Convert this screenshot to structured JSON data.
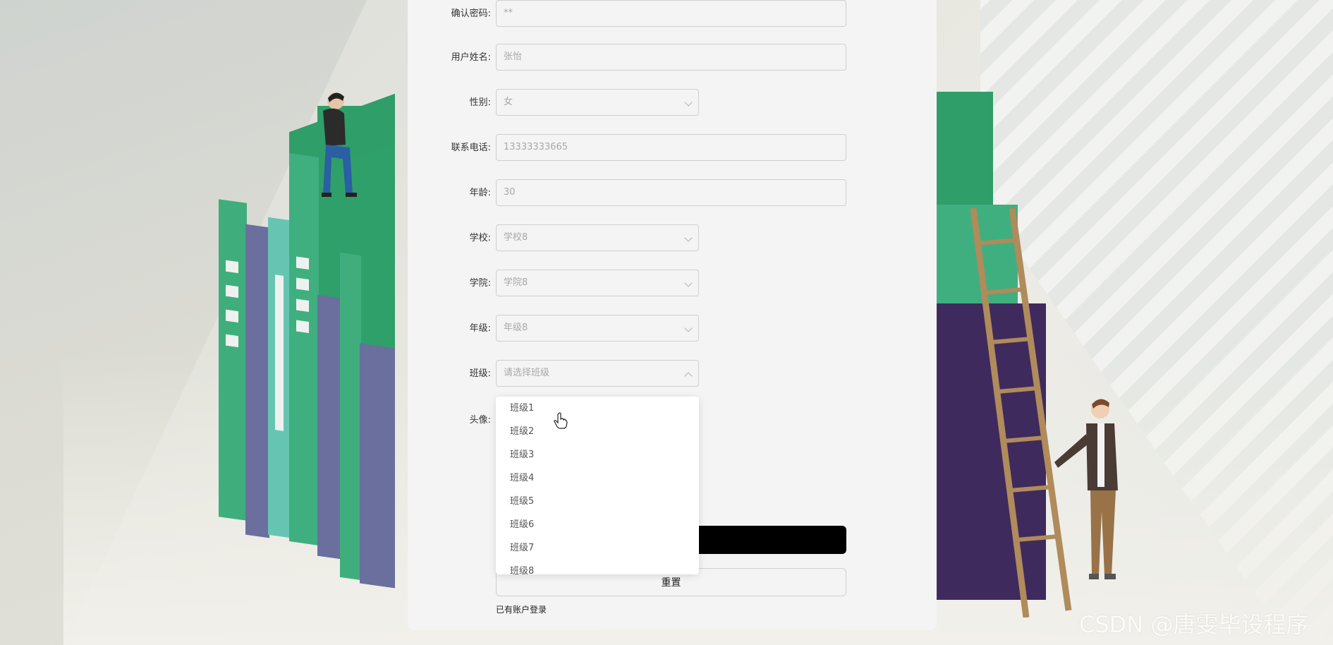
{
  "form": {
    "confirm_password": {
      "label": "确认密码:",
      "value": "**"
    },
    "user_name": {
      "label": "用户姓名:",
      "value": "张怡"
    },
    "gender": {
      "label": "性别:",
      "value": "女"
    },
    "phone": {
      "label": "联系电话:",
      "value": "13333333665"
    },
    "age": {
      "label": "年龄:",
      "value": "30"
    },
    "school": {
      "label": "学校:",
      "value": "学校8"
    },
    "college": {
      "label": "学院:",
      "value": "学院8"
    },
    "grade": {
      "label": "年级:",
      "value": "年级8"
    },
    "class": {
      "label": "班级:",
      "placeholder": "请选择班级"
    },
    "avatar": {
      "label": "头像:"
    }
  },
  "class_dropdown": {
    "options": [
      "班级1",
      "班级2",
      "班级3",
      "班级4",
      "班级5",
      "班级6",
      "班级7",
      "班级8"
    ]
  },
  "buttons": {
    "reset_label": "重置",
    "login_link": "已有账户登录"
  },
  "watermark": "CSDN @唐雯毕设程序",
  "colors": {
    "panel_bg": "#f4f4f4",
    "submit_bg": "#000000",
    "book_green": "#3fae7c",
    "book_purple": "#6a6f9e"
  }
}
